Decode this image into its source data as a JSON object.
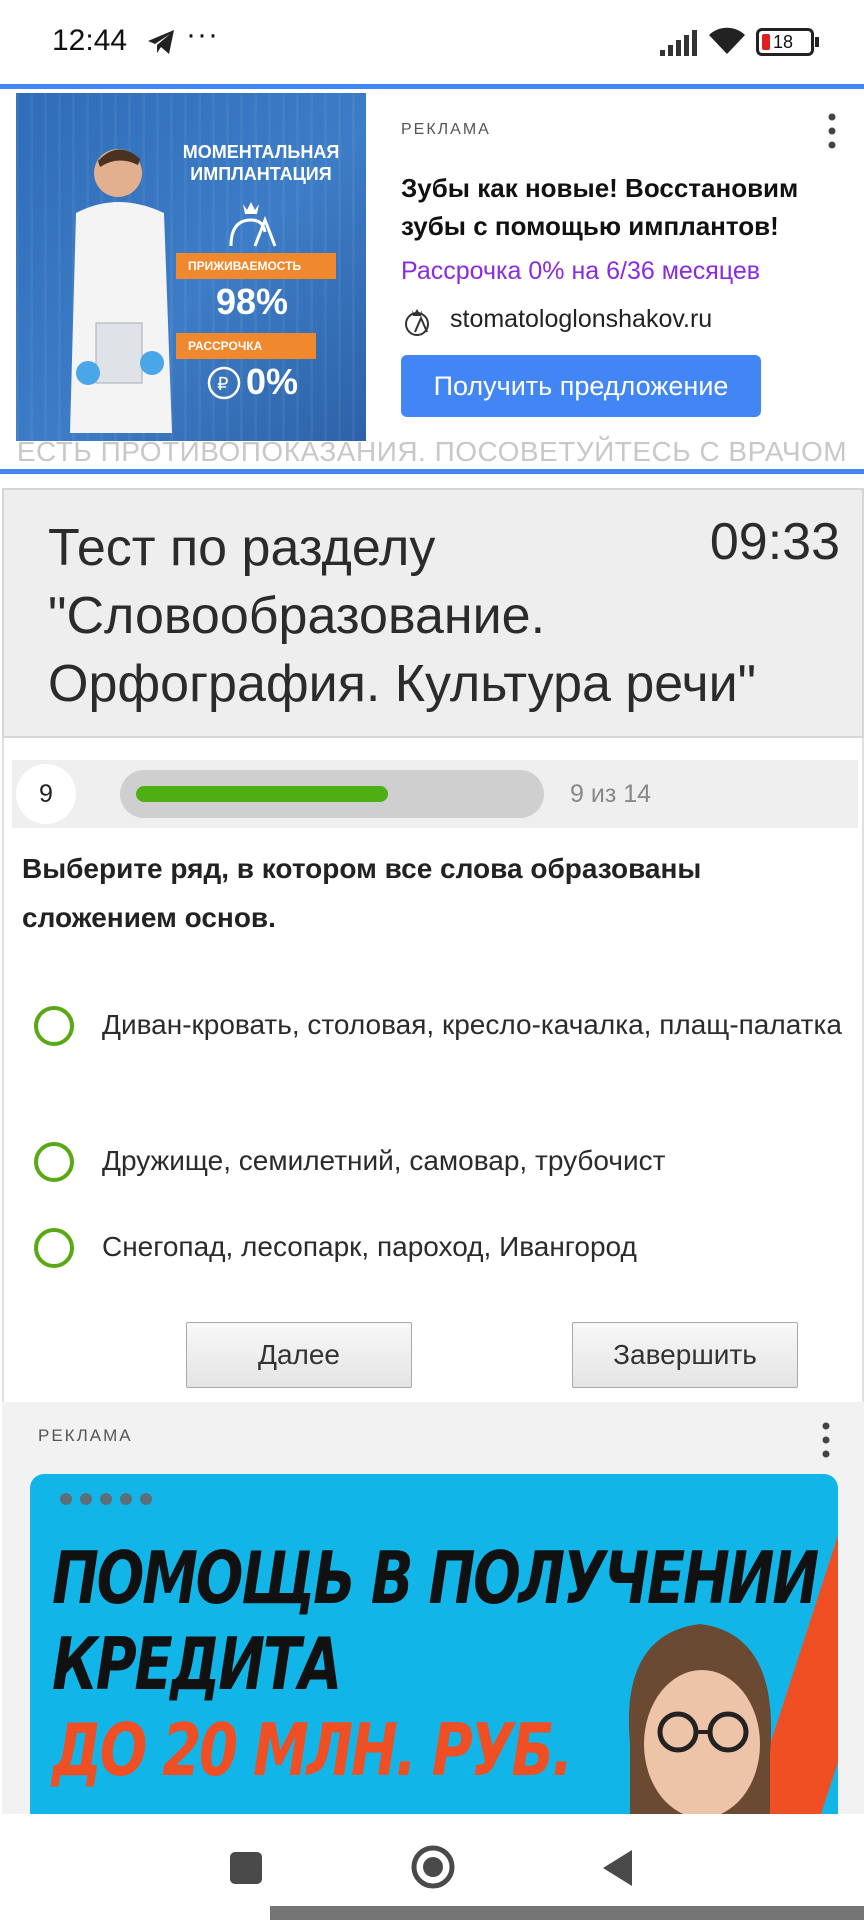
{
  "status_bar": {
    "time": "12:44",
    "dots": "···",
    "battery": "18",
    "icons": [
      "telegram-icon",
      "signal-icon",
      "wifi-icon",
      "battery-icon"
    ]
  },
  "ad_top": {
    "label": "РЕКЛАМА",
    "title": "Зубы как новые! Восстановим зубы с помощью имплантов!",
    "subtitle": "Рассрочка 0% на 6/36 месяцев",
    "domain": "stomatologlonshakov.ru",
    "cta": "Получить предложение",
    "disclaimer": "ЕСТЬ ПРОТИВОПОКАЗАНИЯ. ПОСОВЕТУЙТЕСЬ С ВРАЧОМ",
    "image": {
      "headline": "МОМЕНТАЛЬНАЯ ИМПЛАНТАЦИЯ",
      "tag1": "ПРИЖИВАЕМОСТЬ",
      "value1": "98%",
      "tag2": "РАССРОЧКА",
      "value2": "0%"
    },
    "colors": {
      "accent": "#4285f4",
      "subtitle": "#8a2be2"
    }
  },
  "quiz": {
    "title": "Тест по разделу \"Словообразование. Орфография. Культура речи\"",
    "timer": "09:33",
    "question_number": "9",
    "progress_text": "9 из 14",
    "progress": {
      "current": 9,
      "total": 14
    },
    "question": "Выберите ряд, в котором все слова образованы сложением основ.",
    "options": [
      "Диван-кровать, столовая, кресло-качалка, плащ-палатка",
      "Дружище, семилетний, самовар, трубочист",
      "Снегопад, лесопарк, пароход, Ивангород"
    ],
    "next_label": "Далее",
    "finish_label": "Завершить",
    "colors": {
      "progress": "#4eae14",
      "radio": "#5aa914"
    }
  },
  "ad_bottom": {
    "label": "РЕКЛАМА",
    "line1": "ПОМОЩЬ В ПОЛУЧЕНИИ",
    "line2": "КРЕДИТА",
    "line3": "ДО 20 МЛН. РУБ.",
    "colors": {
      "background": "#12b5e8",
      "accent": "#f04e23"
    }
  },
  "nav_bar": {
    "buttons": [
      "recents-icon",
      "home-icon",
      "back-icon"
    ]
  }
}
